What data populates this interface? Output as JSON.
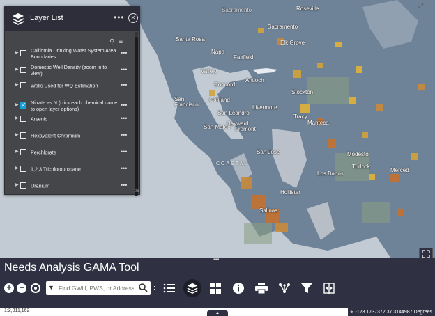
{
  "map": {
    "cities": [
      {
        "name": "Sacramento",
        "cls": "dim"
      },
      {
        "name": "Roseville",
        "cls": "dim"
      },
      {
        "name": "Sacramento",
        "cls": ""
      },
      {
        "name": "Elk Grove",
        "cls": ""
      },
      {
        "name": "Santa Rosa",
        "cls": ""
      },
      {
        "name": "Napa",
        "cls": ""
      },
      {
        "name": "Fairfield",
        "cls": ""
      },
      {
        "name": "Vallejo",
        "cls": ""
      },
      {
        "name": "Concord",
        "cls": ""
      },
      {
        "name": "Antioch",
        "cls": ""
      },
      {
        "name": "Stockton",
        "cls": ""
      },
      {
        "name": "Oakland",
        "cls": ""
      },
      {
        "name": "San Francisco",
        "cls": ""
      },
      {
        "name": "Livermore",
        "cls": ""
      },
      {
        "name": "San Leandro",
        "cls": ""
      },
      {
        "name": "Tracy",
        "cls": ""
      },
      {
        "name": "Hayward",
        "cls": ""
      },
      {
        "name": "Manteca",
        "cls": ""
      },
      {
        "name": "Fremont",
        "cls": ""
      },
      {
        "name": "San Mateo",
        "cls": ""
      },
      {
        "name": "Modesto",
        "cls": ""
      },
      {
        "name": "Turlock",
        "cls": ""
      },
      {
        "name": "San Jose",
        "cls": ""
      },
      {
        "name": "Merced",
        "cls": ""
      },
      {
        "name": "Los Banos",
        "cls": ""
      },
      {
        "name": "Salinas",
        "cls": ""
      },
      {
        "name": "Hollister",
        "cls": ""
      }
    ],
    "coast_label": "COASTAL"
  },
  "layer_panel": {
    "title": "Layer List",
    "more_icon": "more-horizontal-icon",
    "close_icon": "close-circle-icon",
    "layers": [
      {
        "label": "California Drinking Water System Area Boundaries",
        "checked": false
      },
      {
        "label": "Domestic Well Density (zoom in to view)",
        "checked": false
      },
      {
        "label": "Wells Used for WQ Estimation",
        "checked": false
      },
      {
        "label": "Nitrate as N (click each chemical name to open layer options)",
        "checked": true
      },
      {
        "label": "Arsenic",
        "checked": false
      },
      {
        "label": "Hexavalent Chromium",
        "checked": false
      },
      {
        "label": "Perchlorate",
        "checked": false
      },
      {
        "label": "1,2,3 Trichloropropane",
        "checked": false
      },
      {
        "label": "Uranium",
        "checked": false
      }
    ],
    "layer_menu_glyph": "•••"
  },
  "toolbar": {
    "app_title": "Needs Analysis GAMA Tool",
    "zoom_in": "+",
    "zoom_out": "−",
    "search_placeholder": "Find GWU, PWS, or Address",
    "tools": [
      "list-icon",
      "layers-icon",
      "grid-icon",
      "info-icon",
      "print-icon",
      "share-icon",
      "filter-icon",
      "swipe-icon"
    ]
  },
  "status": {
    "scale": "1:2,311,162",
    "coordinates": "-123.1737372 37.3144987 Degrees"
  },
  "colors": {
    "toolbar_bg": "#2f3142",
    "panel_bg": "#45464a",
    "land": "#6e8296",
    "ocean": "#bfc8d1",
    "checkbox_accent": "#1a9fd8"
  }
}
